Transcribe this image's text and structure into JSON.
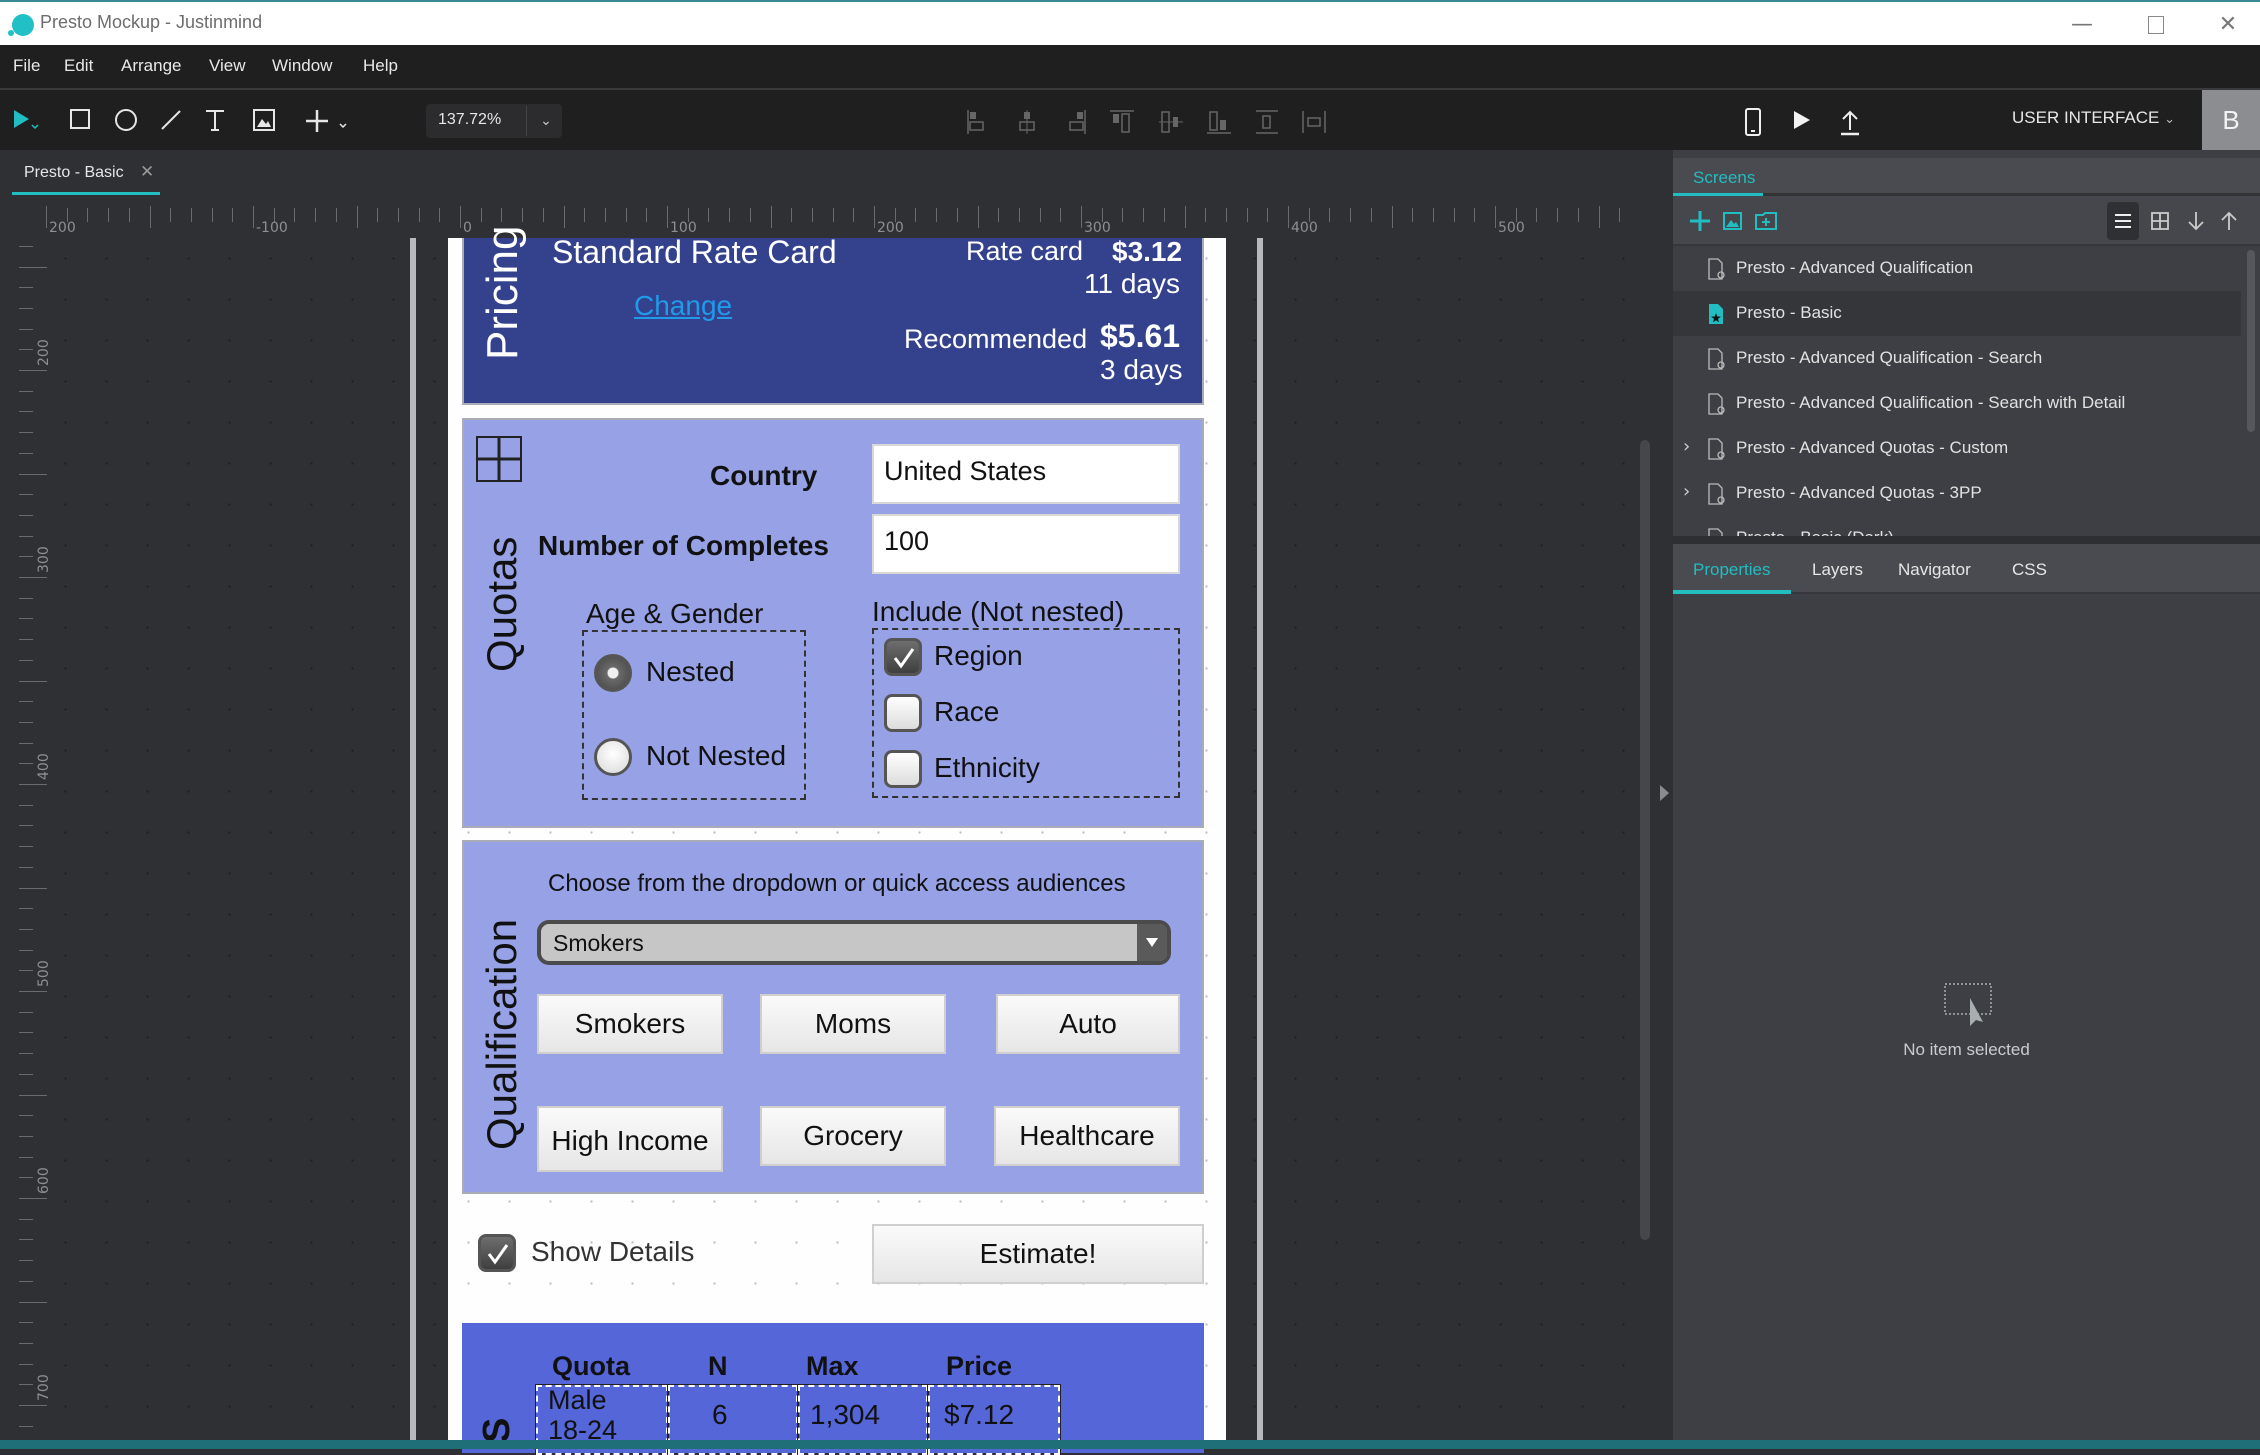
{
  "window": {
    "title": "Presto Mockup  - Justinmind",
    "controls": [
      "minimize-icon",
      "maximize-icon",
      "close-icon"
    ]
  },
  "menu": [
    "File",
    "Edit",
    "Arrange",
    "View",
    "Window",
    "Help"
  ],
  "toolbar": {
    "tools": [
      "select-arrow-icon",
      "rectangle-icon",
      "ellipse-icon",
      "line-icon",
      "text-icon",
      "image-icon",
      "add-plus-icon"
    ],
    "zoom_value": "137.72%",
    "align_tools": [
      "align-left-icon",
      "align-center-h-icon",
      "align-right-icon",
      "align-top-icon",
      "align-middle-v-icon",
      "align-bottom-icon",
      "distribute-vertical-icon",
      "distribute-horizontal-icon"
    ],
    "right_tools": [
      "mobile-device-icon",
      "play-simulate-icon",
      "publish-upload-icon"
    ],
    "mode_label": "USER INTERFACE",
    "avatar_letter": "B"
  },
  "doc_tab": {
    "label": "Presto - Basic"
  },
  "rulers": {
    "horizontal": [
      "200",
      "-100",
      "0",
      "100",
      "200",
      "300",
      "400",
      "500"
    ],
    "vertical": [
      "200",
      "300",
      "400",
      "500",
      "600",
      "700"
    ]
  },
  "mockup": {
    "pricing": {
      "section_label": "Pricing",
      "card_name": "Standard Rate Card",
      "change_link": "Change",
      "rate_card_label": "Rate card",
      "rate_card_price": "$3.12",
      "rate_card_days": "11 days",
      "recommended_label": "Recommended",
      "recommended_price": "$5.61",
      "recommended_days": "3 days"
    },
    "quotas": {
      "section_label": "Quotas",
      "country_label": "Country",
      "country_value": "United States",
      "completes_label": "Number of Completes",
      "completes_value": "100",
      "age_gender_label": "Age & Gender",
      "radios": [
        {
          "label": "Nested",
          "selected": true
        },
        {
          "label": "Not Nested",
          "selected": false
        }
      ],
      "include_label": "Include (Not nested)",
      "checkboxes": [
        {
          "label": "Region",
          "checked": true
        },
        {
          "label": "Race",
          "checked": false
        },
        {
          "label": "Ethnicity",
          "checked": false
        }
      ]
    },
    "qualification": {
      "section_label": "Qualification",
      "instruction": "Choose from the dropdown or quick access audiences",
      "dropdown_value": "Smokers",
      "quick_buttons": [
        "Smokers",
        "Moms",
        "Auto",
        "High Income",
        "Grocery",
        "Healthcare"
      ]
    },
    "actions": {
      "show_details_label": "Show Details",
      "show_details_checked": true,
      "estimate_button": "Estimate!"
    },
    "details": {
      "section_label": "S",
      "headers": [
        "Quota",
        "N",
        "Max",
        "Price"
      ],
      "rows": [
        [
          "Male\n18-24",
          "6",
          "1,304",
          "$7.12"
        ]
      ],
      "row0_quota_line1": "Male",
      "row0_quota_line2": "18-24"
    }
  },
  "right_panel": {
    "screens_tab": "Screens",
    "screen_tools": [
      "add-screen-icon",
      "add-image-screen-icon",
      "add-folder-icon"
    ],
    "view_tools": [
      "list-view-icon",
      "grid-view-icon",
      "move-down-icon",
      "move-up-icon"
    ],
    "screens": [
      {
        "label": "Presto - Advanced Qualification",
        "expandable": false,
        "selected": false
      },
      {
        "label": "Presto - Basic",
        "expandable": false,
        "selected": true
      },
      {
        "label": "Presto - Advanced Qualification - Search",
        "expandable": false,
        "selected": false
      },
      {
        "label": "Presto - Advanced Qualification - Search with Detail",
        "expandable": false,
        "selected": false
      },
      {
        "label": "Presto - Advanced Quotas - Custom",
        "expandable": true,
        "selected": false
      },
      {
        "label": "Presto - Advanced Quotas - 3PP",
        "expandable": true,
        "selected": false
      },
      {
        "label": "Presto - Basic (Dark)",
        "expandable": false,
        "selected": false
      }
    ],
    "prop_tabs": [
      "Properties",
      "Layers",
      "Navigator",
      "CSS"
    ],
    "active_prop_tab": "Properties",
    "empty_state": "No item selected"
  },
  "colors": {
    "accent": "#21bdc1",
    "pricing_bg": "#34418d",
    "section_bg": "#96a1e6",
    "details_bg": "#5566d8",
    "link": "#1f9bea"
  }
}
